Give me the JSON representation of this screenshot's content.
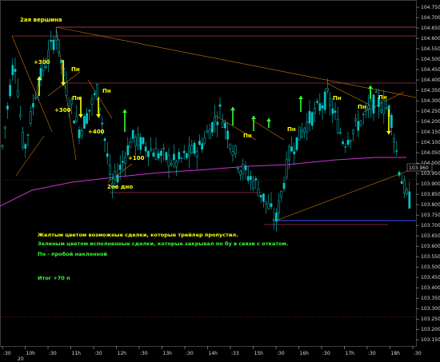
{
  "chart_data": {
    "type": "candlestick",
    "y_range": [
      103.1,
      104.8
    ],
    "y_ticks": [
      "104.750",
      "104.700",
      "104.650",
      "104.600",
      "104.550",
      "104.500",
      "104.450",
      "104.400",
      "104.350",
      "104.300",
      "104.250",
      "104.200",
      "104.150",
      "104.100",
      "104.050",
      "104.000",
      "103.950",
      "103.900",
      "103.850",
      "103.800",
      "103.750",
      "103.700",
      "103.650",
      "103.600",
      "103.550",
      "103.500",
      "103.450",
      "103.400",
      "103.350",
      "103.300",
      "103.250",
      "103.200",
      "103.150"
    ],
    "current_price": "103.960",
    "x_ticks": [
      ":30",
      "10h",
      ":30",
      "11h",
      ":30",
      "12h",
      ":30",
      "13h",
      ":30",
      "14h",
      ":33",
      "15h",
      ":30",
      "16h",
      ":30",
      "17h",
      ":30",
      "18h",
      ":30"
    ],
    "x_date": "20",
    "colors": {
      "candle_up": "#00c8c8",
      "candle_down": "#00c8c8",
      "ma_line": "#cc33cc",
      "trend_line": "#ff9900",
      "level_line": "#a0324a",
      "support_line": "#3355ff",
      "profit_label": "#ffff00",
      "exec_arrow": "#33ff33",
      "note_yellow": "#ffff00",
      "note_green": "#33ff33"
    },
    "annotations": {
      "peak_label": "2ая вершина",
      "bottom_label": "2ое дно",
      "profit_labels": [
        "+300",
        "+300",
        "+400",
        "+100"
      ],
      "breakout_labels": [
        "Пн",
        "Пн",
        "Пн",
        "Пн",
        "Пн",
        "Пн",
        "Пн",
        "Пн"
      ]
    },
    "notes": {
      "yellow": "Желтым цветом возможные сделки, которые трейлер пропустил.",
      "green": "Зеленым цветом исполненные сделки, которые закрывал по бу в связи с откатом.",
      "breakout": "Пн - пробой наклонной",
      "total": "Итог +70 п"
    }
  }
}
